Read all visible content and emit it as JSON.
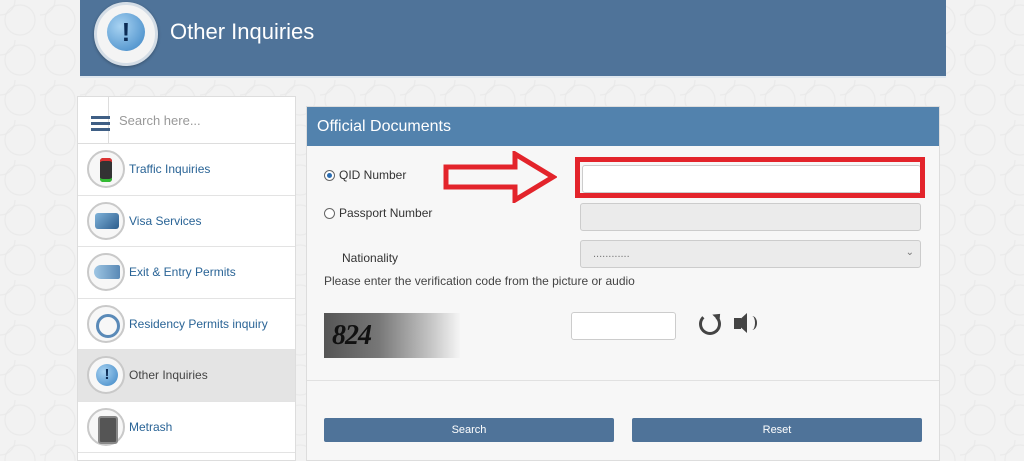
{
  "header": {
    "icon": "exclamation-bubble-icon",
    "title": "Other Inquiries"
  },
  "sidebar": {
    "search_placeholder": "Search here...",
    "items": [
      {
        "label": "Traffic Inquiries",
        "icon": "traffic-light-icon"
      },
      {
        "label": "Visa Services",
        "icon": "visa-icon"
      },
      {
        "label": "Exit & Entry Permits",
        "icon": "airplane-icon"
      },
      {
        "label": "Residency Permits inquiry",
        "icon": "residency-search-icon"
      },
      {
        "label": "Other Inquiries",
        "icon": "exclamation-bubble-icon",
        "active": true
      },
      {
        "label": "Metrash",
        "icon": "phone-icon"
      }
    ]
  },
  "panel": {
    "title": "Official Documents",
    "qid_label": "QID Number",
    "qid_value": "",
    "qid_selected": true,
    "passport_label": "Passport Number",
    "passport_value": "",
    "nationality_label": "Nationality",
    "nationality_selected": "............",
    "instruction": "Please enter the verification code from the picture or audio",
    "captcha_text": "824",
    "captcha_input": "",
    "search_label": "Search",
    "reset_label": "Reset"
  },
  "colors": {
    "header_bg": "#4f7399",
    "panel_header_bg": "#5282ad",
    "button_bg": "#4f7399",
    "link": "#2a6496",
    "annotation_red": "#e3242b"
  }
}
